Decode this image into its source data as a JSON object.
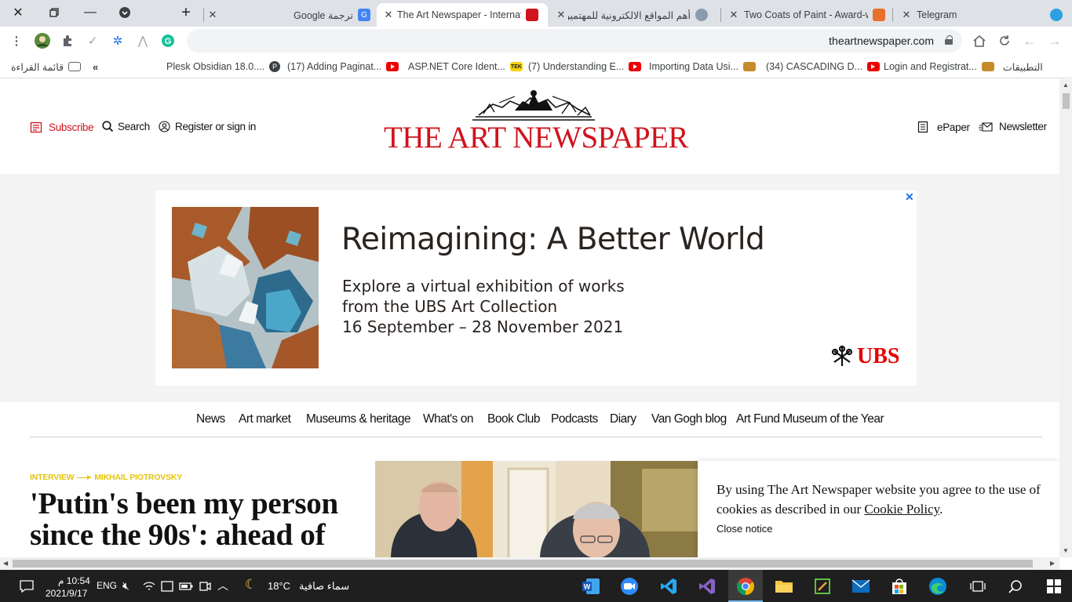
{
  "browser": {
    "tabs": [
      {
        "title": "Telegram",
        "active": false
      },
      {
        "title": "Two Coats of Paint - Award-w",
        "active": false
      },
      {
        "title": "أهم المواقع الالكترونية للمهتمين",
        "active": false
      },
      {
        "title": "The Art Newspaper - Internat",
        "active": true
      },
      {
        "title": "ترجمة Google",
        "active": false
      }
    ],
    "url": "theartnewspaper.com",
    "bookmarks": [
      {
        "label": "التطبيقات"
      },
      {
        "label": "Login and Registrat..."
      },
      {
        "label": "(34) CASCADING D..."
      },
      {
        "label": "Importing Data Usi..."
      },
      {
        "label": "(7) Understanding E..."
      },
      {
        "label": "ASP.NET Core Ident..."
      },
      {
        "label": "(17) Adding Paginat..."
      },
      {
        "label": "Plesk Obsidian 18.0...."
      },
      {
        "label": "قائمة القراءة"
      }
    ],
    "bookmark_overflow": "«"
  },
  "site": {
    "header": {
      "subscribe": "Subscribe",
      "search": "Search",
      "register": "Register or sign in",
      "logo": "THE ART NEWSPAPER",
      "epaper": "ePaper",
      "newsletter": "Newsletter"
    },
    "ad": {
      "title": "Reimagining:  A Better World",
      "line1": "Explore a virtual exhibition of works",
      "line2": "from the UBS Art Collection",
      "line3": "16 September – 28 November 2021",
      "brand": "UBS",
      "close": "✕"
    },
    "nav": [
      "News",
      "Art market",
      "Museums & heritage",
      "What's on",
      "Book Club",
      "Podcasts",
      "Diary",
      "Van Gogh blog",
      "Art Fund Museum of the Year"
    ],
    "article": {
      "kicker_section": "INTERVIEW",
      "kicker_topic": "MIKHAIL PIOTROVSKY",
      "headline": "'Putin's been my person since the 90s': ahead of"
    },
    "cookie": {
      "message_before": "By using The Art Newspaper website you agree to the use of cookies as described in our ",
      "link": "Cookie Policy",
      "message_after": ".",
      "close": "Close notice"
    }
  },
  "taskbar": {
    "time": "10:54 م",
    "date": "2021/9/17",
    "language": "ENG",
    "temperature": "18°C",
    "weather": "سماء صافية"
  },
  "colors": {
    "brand_red": "#d0131d",
    "kicker_yellow": "#e3c40e",
    "ubs_red": "#e60000"
  }
}
